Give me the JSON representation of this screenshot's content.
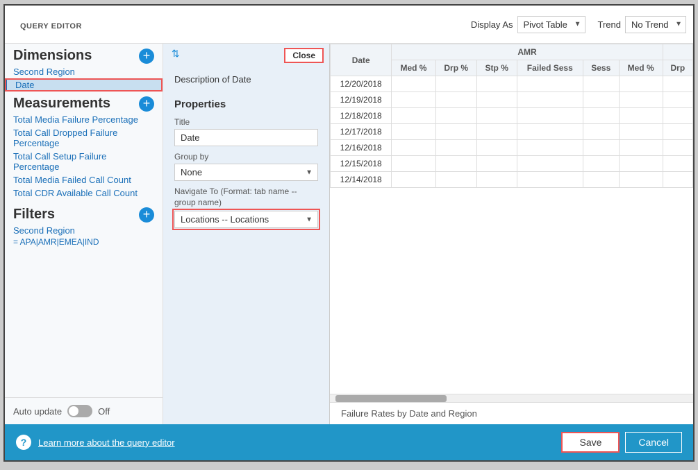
{
  "header": {
    "query_editor_label": "QUERY EDITOR",
    "display_as_label": "Display As",
    "display_as_value": "Pivot Table",
    "trend_label": "Trend",
    "trend_value": "No Trend",
    "close_label": "Close"
  },
  "sidebar": {
    "dimensions_title": "Dimensions",
    "dimensions_items": [
      {
        "label": "Second Region",
        "selected": false
      },
      {
        "label": "Date",
        "selected": true
      }
    ],
    "measurements_title": "Measurements",
    "measurements_items": [
      {
        "label": "Total Media Failure Percentage"
      },
      {
        "label": "Total Call Dropped Failure Percentage"
      },
      {
        "label": "Total Call Setup Failure Percentage"
      },
      {
        "label": "Total Media Failed Call Count"
      },
      {
        "label": "Total CDR Available Call Count"
      }
    ],
    "filters_title": "Filters",
    "filters_items": [
      {
        "label": "Second Region"
      }
    ],
    "filter_value": "= APA|AMR|EMEA|IND",
    "auto_update_label": "Auto update",
    "toggle_state": "Off"
  },
  "middle_panel": {
    "description": "Description of Date",
    "properties_title": "Properties",
    "title_label": "Title",
    "title_value": "Date",
    "group_by_label": "Group by",
    "group_by_value": "None",
    "navigate_label": "Navigate To (Format: tab name -- group name)",
    "navigate_value": "Locations -- Locations",
    "navigate_options": [
      "Locations -- Locations"
    ]
  },
  "table": {
    "date_header": "Date",
    "amr_header": "AMR",
    "sub_headers": [
      "Med %",
      "Drp %",
      "Stp %",
      "Failed Sess",
      "Sess",
      "Med %",
      "Drp"
    ],
    "rows": [
      {
        "date": "12/20/2018",
        "values": []
      },
      {
        "date": "12/19/2018",
        "values": []
      },
      {
        "date": "12/18/2018",
        "values": []
      },
      {
        "date": "12/17/2018",
        "values": []
      },
      {
        "date": "12/16/2018",
        "values": []
      },
      {
        "date": "12/15/2018",
        "values": []
      },
      {
        "date": "12/14/2018",
        "values": []
      }
    ],
    "chart_title": "Failure Rates by Date and Region"
  },
  "bottom_bar": {
    "help_icon": "?",
    "learn_more_text": "Learn more about the query editor",
    "save_label": "Save",
    "cancel_label": "Cancel"
  }
}
